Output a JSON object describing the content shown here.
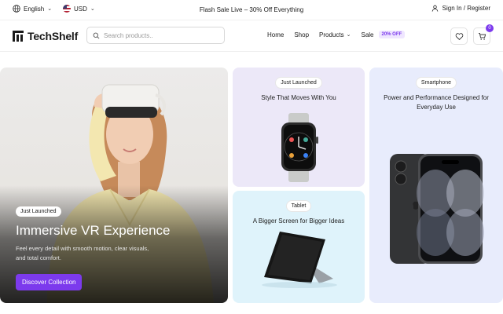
{
  "topbar": {
    "language": "English",
    "currency": "USD",
    "promo": "Flash Sale Live – 30% Off Everything",
    "auth": "Sign In / Register"
  },
  "header": {
    "logo": "TechShelf",
    "search_placeholder": "Search products..",
    "nav": {
      "home": "Home",
      "shop": "Shop",
      "products": "Products",
      "sale": "Sale",
      "sale_badge": "20% OFF"
    },
    "cart_count": "0"
  },
  "hero": {
    "badge": "Just Launched",
    "title": "Immersive VR Experience",
    "description": "Feel every detail with smooth motion, clear visuals, and total comfort.",
    "cta": "Discover Collection"
  },
  "cards": {
    "watch": {
      "badge": "Just Launched",
      "title": "Style That Moves With You"
    },
    "tablet": {
      "badge": "Tablet",
      "title": "A Bigger Screen for Bigger Ideas"
    },
    "phone": {
      "badge": "Smartphone",
      "title": "Power and Performance Designed for Everyday Use"
    }
  },
  "colors": {
    "accent": "#7c3aed",
    "watch_card_bg": "#ece8f8",
    "tablet_card_bg": "#dff3fb",
    "phone_card_bg": "#e8ecfc"
  }
}
